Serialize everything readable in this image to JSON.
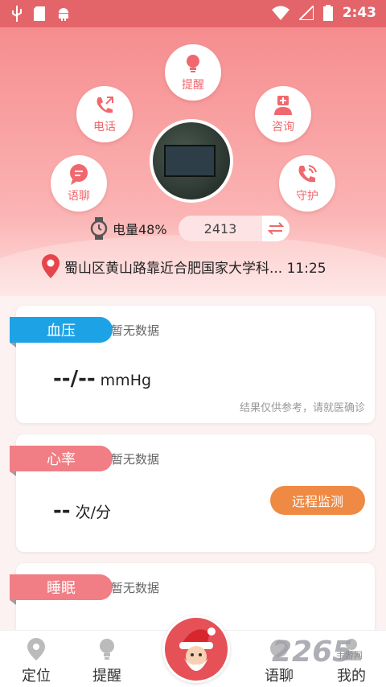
{
  "status_bar": {
    "time": "2:43"
  },
  "actions": {
    "remind": "提醒",
    "call": "电话",
    "consult": "咨询",
    "voice_chat": "语聊",
    "guard": "守护"
  },
  "device": {
    "battery_label": "电量48%",
    "counter_value": "2413",
    "location": "蜀山区黄山路靠近合肥国家大学科... 11:25"
  },
  "cards": {
    "blood_pressure": {
      "tag": "血压",
      "status": "暂无数据",
      "reading": "--/--",
      "unit": "mmHg",
      "note": "结果仅供参考，请就医确诊"
    },
    "heart_rate": {
      "tag": "心率",
      "status": "暂无数据",
      "reading": "--",
      "unit": "次/分",
      "button": "远程监测"
    },
    "sleep": {
      "tag": "睡眠",
      "status": "暂无数据"
    }
  },
  "nav": {
    "locate": "定位",
    "remind": "提醒",
    "voice_chat": "语聊",
    "mine": "我的"
  },
  "watermark": {
    "text": "2265",
    "sub": "手游网"
  },
  "colors": {
    "accent": "#f0686e",
    "blue_tag": "#1ea2e6",
    "pink_tag": "#f07e84",
    "orange_button": "#ef8a44"
  }
}
